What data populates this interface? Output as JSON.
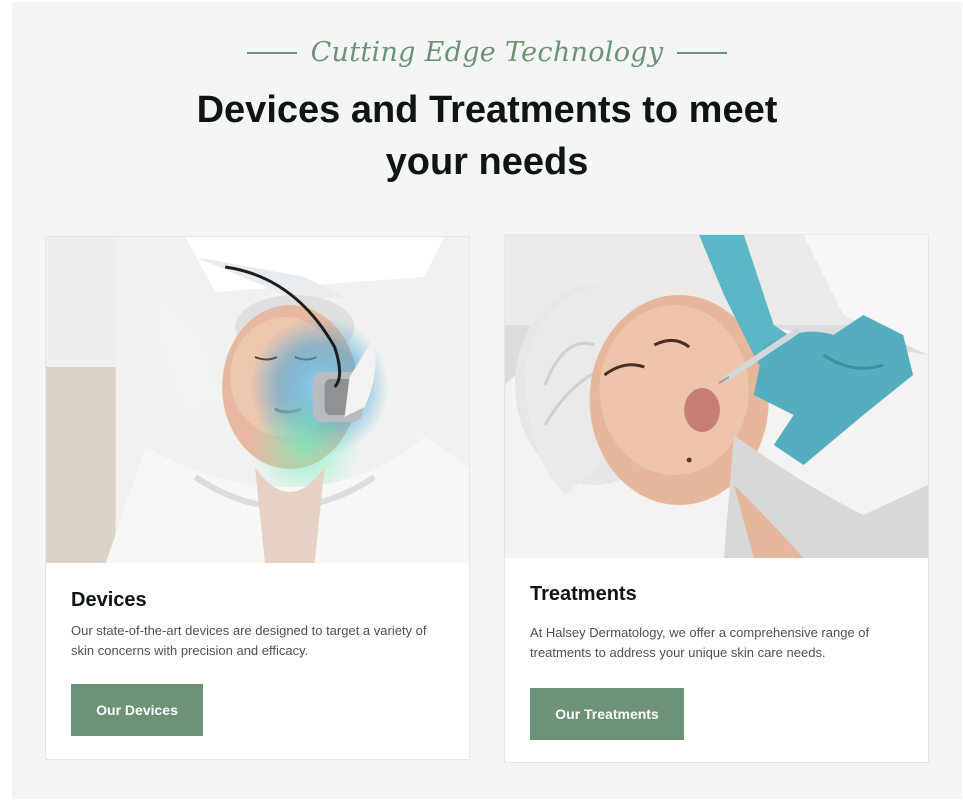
{
  "eyebrow": "Cutting Edge Technology",
  "heading": "Devices and Treatments to meet your needs",
  "cards": [
    {
      "title": "Devices",
      "description": "Our state-of-the-art devices are designed to target a variety of skin concerns with precision and efficacy.",
      "button_label": "Our Devices",
      "image_icon": "led-facial-device-photo"
    },
    {
      "title": "Treatments",
      "description": "At Halsey Dermatology, we offer a comprehensive range of treatments to address your unique skin care needs.",
      "button_label": "Our Treatments",
      "image_icon": "injection-treatment-photo"
    }
  ],
  "colors": {
    "accent": "#6e9276",
    "section_bg": "#f4f6f5",
    "heading": "#0f1414",
    "body_text": "#4d5352",
    "glove": "#5bb6c6",
    "led_light": "#2fa0d8"
  }
}
